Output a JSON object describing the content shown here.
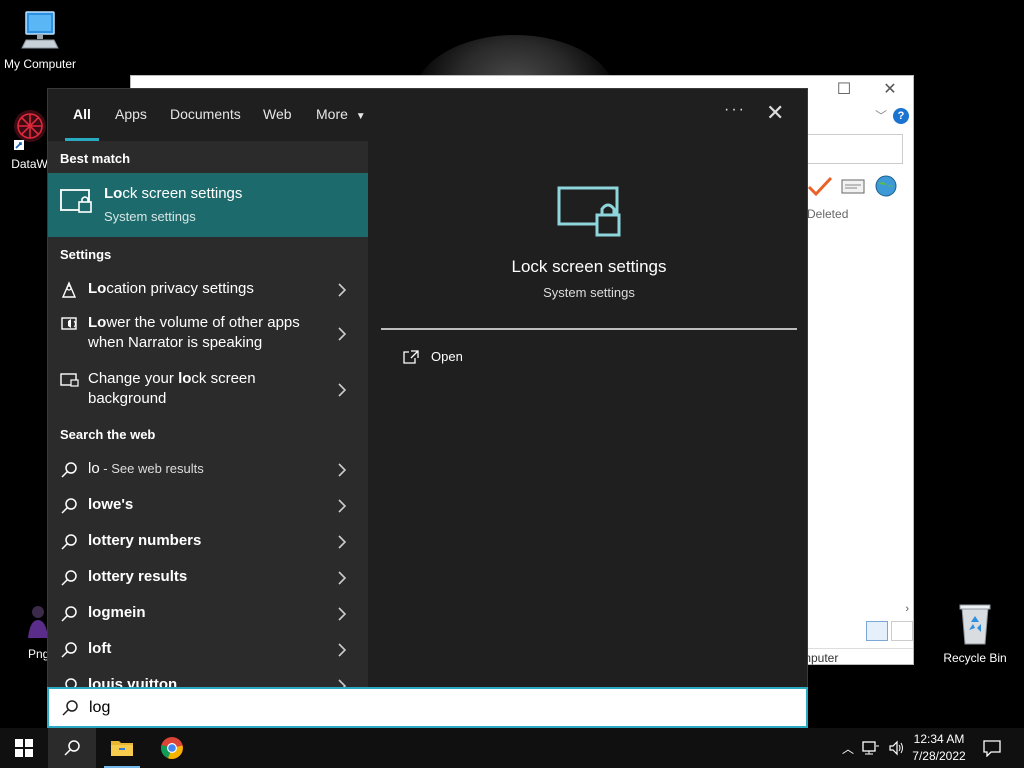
{
  "desktop": {
    "icons": [
      {
        "label": "My Computer"
      },
      {
        "label": "DataWag"
      },
      {
        "label": "Png"
      },
      {
        "label": "Recycle Bin"
      }
    ]
  },
  "background_window": {
    "deleted_label": "Deleted",
    "status_label": "mputer",
    "help_label": "?"
  },
  "search": {
    "tabs": [
      {
        "label": "All",
        "active": true
      },
      {
        "label": "Apps"
      },
      {
        "label": "Documents"
      },
      {
        "label": "Web"
      },
      {
        "label": "More"
      }
    ],
    "best_match_title": "Best match",
    "best_match": {
      "title_bold": "Lo",
      "title_rest": "ck screen settings",
      "subtitle": "System settings"
    },
    "settings_title": "Settings",
    "settings_items": [
      {
        "bold": "Lo",
        "rest": "cation privacy settings"
      },
      {
        "bold": "Lo",
        "rest": "wer the volume of other apps when Narrator is speaking"
      },
      {
        "pre": "Change your ",
        "bold": "lo",
        "rest": "ck screen background"
      }
    ],
    "web_title": "Search the web",
    "web_items": [
      {
        "text": "lo",
        "sub": " - See web results"
      },
      {
        "text": "lowe's"
      },
      {
        "text": "lottery numbers"
      },
      {
        "text": "lottery results"
      },
      {
        "text": "logmein"
      },
      {
        "text": "loft"
      },
      {
        "text": "louis vuitton"
      }
    ],
    "preview": {
      "title": "Lock screen settings",
      "subtitle": "System settings",
      "action_open": "Open"
    },
    "query": "log"
  },
  "taskbar": {
    "time": "12:34 AM",
    "date": "7/28/2022"
  },
  "colors": {
    "accent": "#2aa9c2",
    "best_match_bg": "#1d6a6c",
    "panel_bg": "#1f1f1f",
    "results_bg": "#2b2b2b"
  }
}
